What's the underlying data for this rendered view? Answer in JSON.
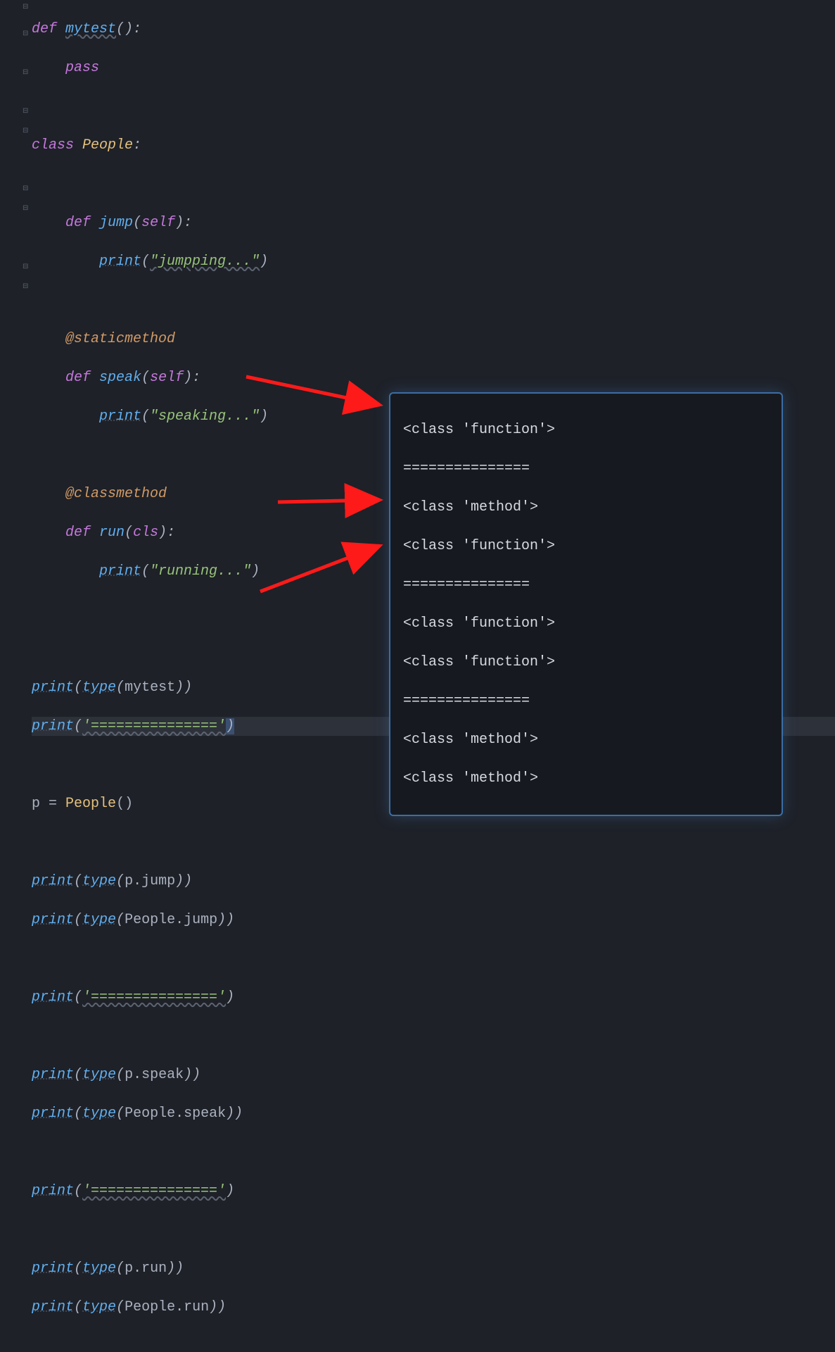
{
  "code": {
    "l1_def": "def",
    "l1_fn": "mytest",
    "l1_rest": "():",
    "l2_pass": "pass",
    "l4_class_kw": "class",
    "l4_class_name": "People",
    "l4_colon": ":",
    "l6_def": "def",
    "l6_fn": "jump",
    "l6_open": "(",
    "l6_self": "self",
    "l6_close": "):",
    "l7_print": "print",
    "l7_open": "(",
    "l7_str": "\"jumpping...\"",
    "l7_close": ")",
    "l9_dec": "@staticmethod",
    "l10_def": "def",
    "l10_fn": "speak",
    "l10_open": "(",
    "l10_self": "self",
    "l10_close": "):",
    "l11_print": "print",
    "l11_open": "(",
    "l11_str": "\"speaking...\"",
    "l11_close": ")",
    "l13_dec": "@classmethod",
    "l14_def": "def",
    "l14_fn": "run",
    "l14_open": "(",
    "l14_cls": "cls",
    "l14_close": "):",
    "l15_print": "print",
    "l15_open": "(",
    "l15_str": "\"running...\"",
    "l15_close": ")",
    "l18_print": "print",
    "l18_open": "(",
    "l18_type": "type",
    "l18_open2": "(",
    "l18_arg": "mytest",
    "l18_close": "))",
    "l19_print": "print",
    "l19_open": "(",
    "l19_str": "'==============='",
    "l19_close": ")",
    "l21_p": "p ",
    "l21_eq": "=",
    "l21_sp": " ",
    "l21_people": "People",
    "l21_paren": "()",
    "l23_print": "print",
    "l23_open": "(",
    "l23_type": "type",
    "l23_open2": "(",
    "l23_arg": "p.jump",
    "l23_close": "))",
    "l24_print": "print",
    "l24_open": "(",
    "l24_type": "type",
    "l24_open2": "(",
    "l24_arg": "People.jump",
    "l24_close": "))",
    "l26_print": "print",
    "l26_open": "(",
    "l26_str": "'==============='",
    "l26_close": ")",
    "l28_print": "print",
    "l28_open": "(",
    "l28_type": "type",
    "l28_open2": "(",
    "l28_arg": "p.speak",
    "l28_close": "))",
    "l29_print": "print",
    "l29_open": "(",
    "l29_type": "type",
    "l29_open2": "(",
    "l29_arg": "People.speak",
    "l29_close": "))",
    "l31_print": "print",
    "l31_open": "(",
    "l31_str": "'==============='",
    "l31_close": ")",
    "l33_print": "print",
    "l33_open": "(",
    "l33_type": "type",
    "l33_open2": "(",
    "l33_arg": "p.run",
    "l33_close": "))",
    "l34_print": "print",
    "l34_open": "(",
    "l34_type": "type",
    "l34_open2": "(",
    "l34_arg": "People.run",
    "l34_close": "))"
  },
  "output": {
    "l1": "<class 'function'>",
    "l2": "===============",
    "l3": "<class 'method'>",
    "l4": "<class 'function'>",
    "l5": "===============",
    "l6": "<class 'function'>",
    "l7": "<class 'function'>",
    "l8": "===============",
    "l9": "<class 'method'>",
    "l10": "<class 'method'>"
  },
  "gutter": {
    "fold_open": "⊟",
    "fold_close": "⊟"
  }
}
